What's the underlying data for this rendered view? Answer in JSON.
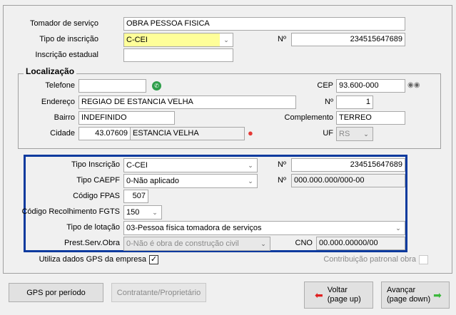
{
  "tomador": {
    "label": "Tomador de serviço",
    "value": "OBRA PESSOA FISICA"
  },
  "tipo_inscricao": {
    "label": "Tipo de inscrição",
    "value": "C-CEI",
    "num_label": "Nº",
    "num_value": "234515647689"
  },
  "inscricao_estadual": {
    "label": "Inscrição estadual",
    "value": ""
  },
  "localizacao": {
    "title": "Localização",
    "telefone": {
      "label": "Telefone",
      "value": ""
    },
    "cep": {
      "label": "CEP",
      "value": "93.600-000"
    },
    "endereco": {
      "label": "Endereço",
      "value": "REGIAO DE ESTANCIA VELHA"
    },
    "numero": {
      "label": "Nº",
      "value": "1"
    },
    "bairro": {
      "label": "Bairro",
      "value": "INDEFINIDO"
    },
    "complemento": {
      "label": "Complemento",
      "value": "TERREO"
    },
    "cidade": {
      "label": "Cidade",
      "code": "43.07609",
      "name": "ESTANCIA VELHA"
    },
    "uf": {
      "label": "UF",
      "value": "RS"
    }
  },
  "gps": {
    "tipo_inscricao": {
      "label": "Tipo Inscrição",
      "value": "C-CEI",
      "num_label": "Nº",
      "num_value": "234515647689"
    },
    "tipo_caepf": {
      "label": "Tipo CAEPF",
      "value": "0-Não aplicado",
      "num_label": "Nº",
      "num_value": "000.000.000/000-00"
    },
    "fpas": {
      "label": "Código FPAS",
      "value": "507"
    },
    "fgts": {
      "label": "Código Recolhimento FGTS",
      "value": "150"
    },
    "lotacao": {
      "label": "Tipo de lotação",
      "value": "03-Pessoa física tomadora de serviços"
    },
    "prest_serv": {
      "label": "Prest.Serv.Obra",
      "value": "0-Não é obra de construção civil"
    },
    "cno": {
      "label": "CNO",
      "value": "00.000.00000/00"
    }
  },
  "utiliza_gps": {
    "label": "Utiliza dados GPS da empresa",
    "checked": true
  },
  "contribuicao": {
    "label": "Contribuição patronal obra",
    "checked": false
  },
  "buttons": {
    "gps_periodo": "GPS por período",
    "contratante": "Contratante/Proprietário",
    "voltar": "Voltar",
    "voltar_sub": "(page up)",
    "avancar": "Avançar",
    "avancar_sub": "(page down)"
  },
  "colors": {
    "highlight": "#ffff99",
    "frame": "#0b3a9e"
  }
}
